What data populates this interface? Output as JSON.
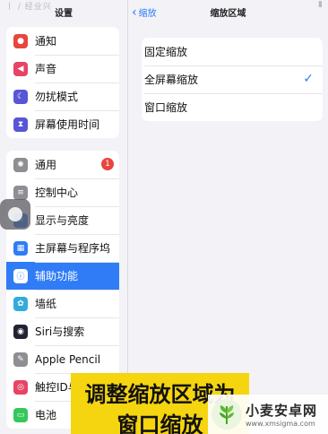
{
  "left": {
    "title": "设置",
    "corner_mark": "丨 / 经业兴",
    "groups": [
      [
        {
          "label": "通知",
          "icon": "bell-icon",
          "color": "#e8453c"
        },
        {
          "label": "声音",
          "icon": "speaker-icon",
          "color": "#e84366"
        },
        {
          "label": "勿扰模式",
          "icon": "moon-icon",
          "color": "#5856d6"
        },
        {
          "label": "屏幕使用时间",
          "icon": "hourglass-icon",
          "color": "#5856d6"
        }
      ],
      [
        {
          "label": "通用",
          "icon": "gear-icon",
          "color": "#8e8e93",
          "badge": "1"
        },
        {
          "label": "控制中心",
          "icon": "toggles-icon",
          "color": "#8e8e93"
        },
        {
          "label": "显示与亮度",
          "icon": "brightness-icon",
          "color": "#2f7cf6"
        },
        {
          "label": "主屏幕与程序坞",
          "icon": "grid-icon",
          "color": "#2f7cf6"
        },
        {
          "label": "辅助功能",
          "icon": "accessibility-icon",
          "color": "#2f7cf6",
          "selected": true
        },
        {
          "label": "墙纸",
          "icon": "flower-icon",
          "color": "#34aadc"
        },
        {
          "label": "Siri与搜索",
          "icon": "siri-icon",
          "color": "#222233"
        },
        {
          "label": "Apple Pencil",
          "icon": "pencil-icon",
          "color": "#8e8e93"
        },
        {
          "label": "触控ID与密码",
          "icon": "fingerprint-icon",
          "color": "#e84366"
        },
        {
          "label": "电池",
          "icon": "battery-icon",
          "color": "#34c759"
        }
      ]
    ]
  },
  "right": {
    "back_label": "缩放",
    "title": "缩放区域",
    "options": [
      {
        "label": "固定缩放",
        "checked": false
      },
      {
        "label": "全屏幕缩放",
        "checked": true
      },
      {
        "label": "窗口缩放",
        "checked": false
      }
    ]
  },
  "overlay": {
    "caption_line1": "调整缩放区域为",
    "caption_line2": "窗口缩放",
    "caption_color": "#f5d50f",
    "logo_name": "小麦安卓网",
    "logo_url": "www.xmsigma.com"
  },
  "colors": {
    "accent": "#2f7cf6",
    "badge": "#e8453c"
  }
}
